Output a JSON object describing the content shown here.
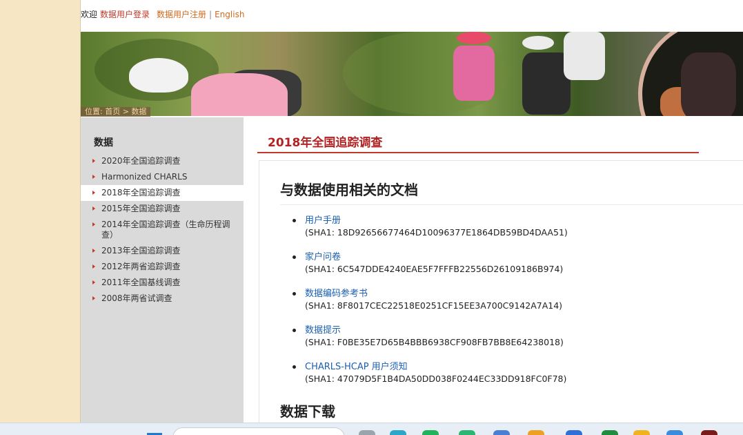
{
  "header": {
    "welcome": "欢迎",
    "login_link": "数据用户登录",
    "register_link": "数据用户注册",
    "separator": "|",
    "english_link": "English"
  },
  "breadcrumb": {
    "prefix": "位置:",
    "home": "首页",
    "arrow": ">",
    "current": "数据"
  },
  "sidebar": {
    "heading": "数据",
    "items": [
      {
        "label": "2020年全国追踪调查",
        "active": false
      },
      {
        "label": "Harmonized CHARLS",
        "active": false
      },
      {
        "label": "2018年全国追踪调查",
        "active": true
      },
      {
        "label": "2015年全国追踪调查",
        "active": false
      },
      {
        "label": "2014年全国追踪调查（生命历程调查）",
        "active": false
      },
      {
        "label": "2013年全国追踪调查",
        "active": false
      },
      {
        "label": "2012年两省追踪调查",
        "active": false
      },
      {
        "label": "2011年全国基线调查",
        "active": false
      },
      {
        "label": "2008年两省试调查",
        "active": false
      }
    ]
  },
  "main": {
    "page_title": "2018年全国追踪调查",
    "section_title": "与数据使用相关的文档",
    "documents": [
      {
        "label": "用户手册",
        "sha": "(SHA1: 18D92656677464D10096377E1864DB59BD4DAA51)"
      },
      {
        "label": "家户问卷",
        "sha": "(SHA1: 6C547DDE4240EAE5F7FFFB22556D26109186B974)"
      },
      {
        "label": "数据编码参考书",
        "sha": "(SHA1: 8F8017CEC22518E0251CF15EE3A700C9142A7A14)"
      },
      {
        "label": "数据提示",
        "sha": "(SHA1: F0BE35E7D65B4BBB6938CF908FB7BB8E64238018)"
      },
      {
        "label": "CHARLS-HCAP 用户须知",
        "sha": "(SHA1: 47079D5F1B4DA50DD038F0244EC33DD918FC0F78)"
      }
    ],
    "download_title": "数据下载"
  },
  "colors": {
    "accent_red": "#b22222",
    "link_blue": "#1a5fb4",
    "link_orange": "#d2691e",
    "sidebar_bg": "#dadada",
    "gutter_bg": "#f7e6c4"
  }
}
